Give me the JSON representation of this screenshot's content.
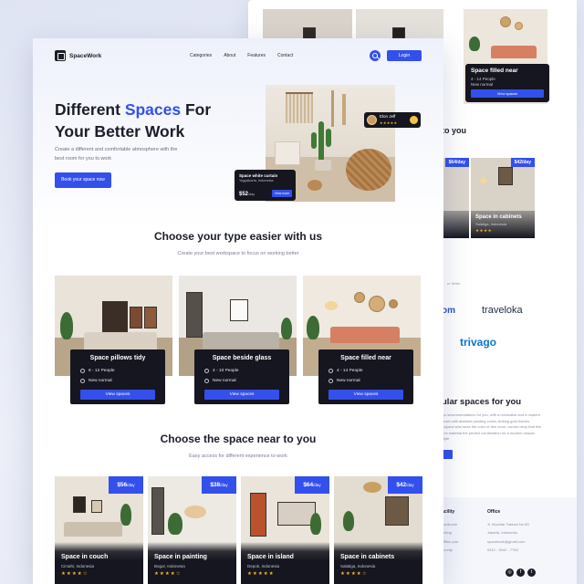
{
  "brand": {
    "name": "SpaceWork"
  },
  "nav": {
    "links": [
      "Categories",
      "About",
      "Features",
      "Contact"
    ],
    "login_label": "Login"
  },
  "hero": {
    "title_part1": "Different ",
    "title_accent": "Spaces",
    "title_part2": " For",
    "title_line2": "Your Better Work",
    "subtitle": "Create a different and comfortable atmosphere with the best room for you to work",
    "cta_label": "Book your space now",
    "user_name": "Elon Jeff",
    "user_rating": "★★★★★",
    "card_title": "Space white curtain",
    "card_location": "Yogyakarta, Indonesia",
    "card_price": "$52",
    "card_price_unit": "/day",
    "card_button": "View room"
  },
  "types_section": {
    "title": "Choose your type easier with us",
    "subtitle": "Create your best workspace to focus on working better",
    "button_label": "View spaces",
    "cards": [
      {
        "title": "Space pillows tidy",
        "people": "6 - 12 People",
        "condition": "New normal"
      },
      {
        "title": "Space beside glass",
        "people": "4 - 10 People",
        "condition": "New normal"
      },
      {
        "title": "Space filled near",
        "people": "4 - 14 People",
        "condition": "New normal"
      }
    ]
  },
  "near_section": {
    "title": "Choose the space near to you",
    "subtitle": "Easy access for different experience to work",
    "cards": [
      {
        "title": "Space in couch",
        "location": "Cimahi, Indonesia",
        "price": "$56",
        "unit": "/day",
        "stars": "★★★★☆"
      },
      {
        "title": "Space in painting",
        "location": "Bogor, Indonesia",
        "price": "$38",
        "unit": "/day",
        "stars": "★★★★☆"
      },
      {
        "title": "Space in island",
        "location": "Depok, Indonesia",
        "price": "$64",
        "unit": "/day",
        "stars": "★★★★★"
      },
      {
        "title": "Space in cabinets",
        "location": "Salatiga, Indonesia",
        "price": "$42",
        "unit": "/day",
        "stars": "★★★★☆"
      }
    ]
  },
  "back_page": {
    "hero_card_title": "Space filled near",
    "hero_card_people": "4 - 14 People",
    "hero_card_condition": "New normal",
    "hero_card_button": "View spaces",
    "near_title_fragment": "to you",
    "near_cards": [
      {
        "title": "d",
        "price": "$64",
        "unit": "/day"
      },
      {
        "title": "Space in cabinets",
        "location": "Salatiga, Indonesia",
        "price": "$42",
        "unit": "/day",
        "stars": "★★★★"
      }
    ],
    "partners_caption": "ur fields",
    "partner_com": "om",
    "partner_traveloka": "traveloka",
    "partner_trivago": "trivago",
    "popular_title": "ular spaces for you",
    "popular_text": "ea recommendations for you, with a minimalist and a modern touch with abstract painting colors striking gold frames. Anyone who sees the color of this room, cannot deny that this one material the perfect combination for a modern classic-style",
    "footer": {
      "col1_heading": "acility",
      "col1_items": [
        "oardroom",
        "orking",
        "Office pod",
        "ecurity"
      ],
      "col2_heading": "Office",
      "col2_items": [
        "Jl. Muchtar Tabrani No 5D",
        "Jakarta, Indonesia",
        "spacework@gmail.com",
        "0812 - 9342 - 7784"
      ]
    }
  }
}
